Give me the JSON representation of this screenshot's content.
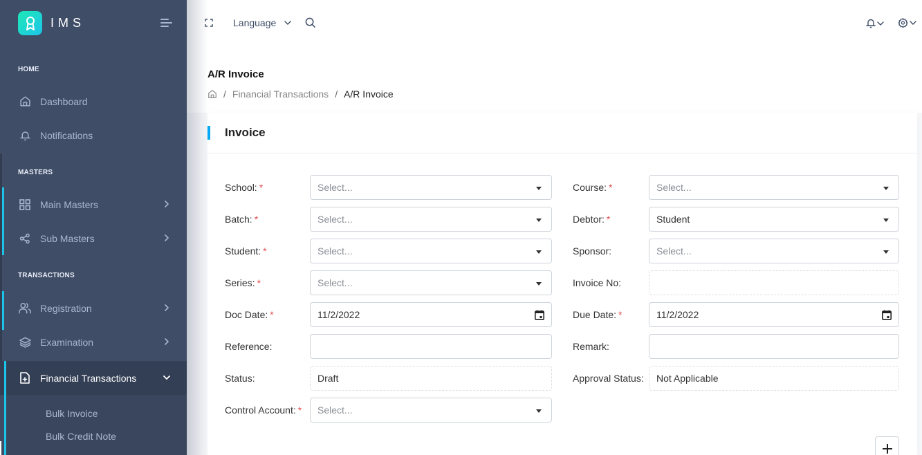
{
  "brand": {
    "name": "IMS",
    "logo_icon": "award-ribbon-icon"
  },
  "sidebar": {
    "sections": [
      {
        "label": "HOME"
      },
      {
        "label": "MASTERS"
      },
      {
        "label": "TRANSACTIONS"
      }
    ],
    "items": [
      {
        "label": "Dashboard",
        "icon": "home-icon"
      },
      {
        "label": "Notifications",
        "icon": "bell-icon"
      },
      {
        "label": "Main Masters",
        "icon": "grid-icon",
        "has_children": true
      },
      {
        "label": "Sub Masters",
        "icon": "share-icon",
        "has_children": true
      },
      {
        "label": "Registration",
        "icon": "users-icon",
        "has_children": true
      },
      {
        "label": "Examination",
        "icon": "layers-icon",
        "has_children": true
      },
      {
        "label": "Financial Transactions",
        "icon": "file-plus-icon",
        "has_children": true,
        "expanded": true,
        "active": true
      }
    ],
    "sub_items": [
      {
        "label": "Bulk Invoice"
      },
      {
        "label": "Bulk Credit Note"
      }
    ]
  },
  "header": {
    "language_label": "Language",
    "icons": [
      "fullscreen-icon",
      "search-icon",
      "bell-icon",
      "settings-icon"
    ]
  },
  "page": {
    "title": "A/R Invoice",
    "breadcrumb": [
      {
        "label": "Financial Transactions"
      },
      {
        "label": "A/R Invoice"
      }
    ]
  },
  "card": {
    "title": "Invoice",
    "accent_color": "#04a9f5"
  },
  "form": {
    "school": {
      "label": "School:",
      "required": "*",
      "value": "",
      "placeholder": "Select..."
    },
    "batch": {
      "label": "Batch:",
      "required": "*",
      "value": "",
      "placeholder": "Select..."
    },
    "student": {
      "label": "Student:",
      "required": "*",
      "value": "",
      "placeholder": "Select..."
    },
    "series": {
      "label": "Series:",
      "required": "*",
      "value": "",
      "placeholder": "Select..."
    },
    "doc_date": {
      "label": "Doc Date:",
      "required": "*",
      "value": "11/2/2022"
    },
    "reference": {
      "label": "Reference:",
      "value": ""
    },
    "status": {
      "label": "Status:",
      "value": "Draft"
    },
    "control_account": {
      "label": "Control Account:",
      "required": "*",
      "value": "",
      "placeholder": "Select..."
    },
    "course": {
      "label": "Course:",
      "required": "*",
      "value": "",
      "placeholder": "Select..."
    },
    "debtor": {
      "label": "Debtor:",
      "required": "*",
      "value": "Student"
    },
    "sponsor": {
      "label": "Sponsor:",
      "value": "",
      "placeholder": "Select..."
    },
    "invoice_no": {
      "label": "Invoice No:",
      "value": ""
    },
    "due_date": {
      "label": "Due Date:",
      "required": "*",
      "value": "11/2/2022"
    },
    "remark": {
      "label": "Remark:",
      "value": ""
    },
    "approval_status": {
      "label": "Approval Status:",
      "value": "Not Applicable"
    }
  },
  "actions": {
    "add_icon": "plus-icon"
  },
  "colors": {
    "sidebar_bg": "#3f4d67",
    "sidebar_active_bg": "#333f54",
    "sidebar_accent": "#1dc4e9",
    "required": "#e35050"
  }
}
